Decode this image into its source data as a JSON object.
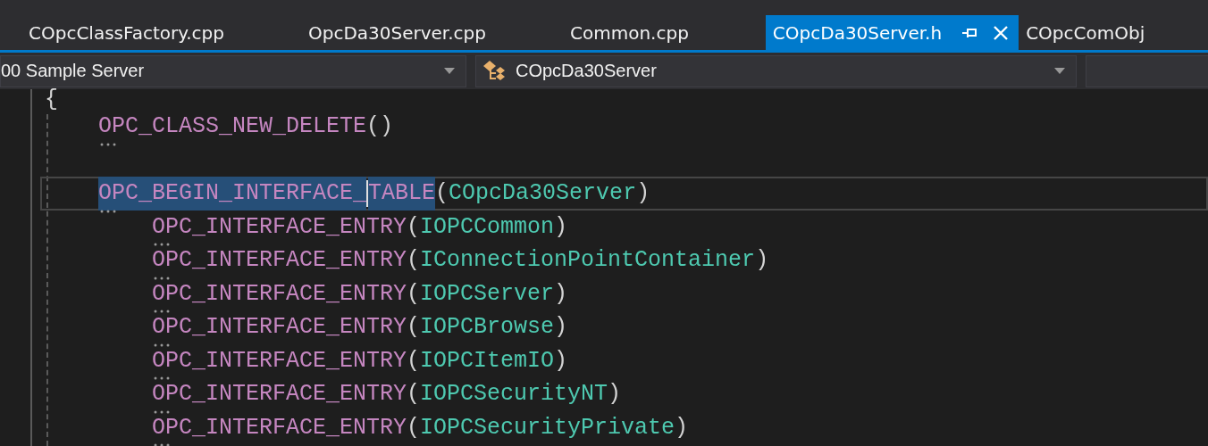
{
  "tabs": [
    {
      "label": "COpcClassFactory.cpp",
      "selected": false
    },
    {
      "label": "OpcDa30Server.cpp",
      "selected": false
    },
    {
      "label": "Common.cpp",
      "selected": false
    },
    {
      "label": "COpcDa30Server.h",
      "selected": true
    },
    {
      "label": "COpcComObj",
      "selected": false
    }
  ],
  "navigation": {
    "project": "00 Sample Server",
    "scope": "COpcDa30Server"
  },
  "code_lines": [
    {
      "current": false,
      "tokens": [
        {
          "kind": "punct",
          "text": "{"
        }
      ]
    },
    {
      "current": false,
      "tokens": [
        {
          "kind": "indent"
        },
        {
          "kind": "macro",
          "text": "OPC_CLASS_NEW_DELETE",
          "hint": true
        },
        {
          "kind": "punct",
          "text": "()"
        }
      ]
    },
    {
      "current": false
    },
    {
      "current": true,
      "tokens": [
        {
          "kind": "indent"
        },
        {
          "kind": "macro",
          "text": "OPC_BEGIN_INTERFACE_",
          "hint": true,
          "selected": true
        },
        {
          "kind": "caret"
        },
        {
          "kind": "macro",
          "text": "TABLE",
          "selected": true
        },
        {
          "kind": "punct",
          "text": "("
        },
        {
          "kind": "type",
          "text": "COpcDa30Server"
        },
        {
          "kind": "punct",
          "text": ")"
        }
      ]
    },
    {
      "current": false,
      "tokens": [
        {
          "kind": "indent"
        },
        {
          "kind": "indent"
        },
        {
          "kind": "macro",
          "text": "OPC_INTERFACE_ENTRY",
          "hint": true
        },
        {
          "kind": "punct",
          "text": "("
        },
        {
          "kind": "type",
          "text": "IOPCCommon"
        },
        {
          "kind": "punct",
          "text": ")"
        }
      ]
    },
    {
      "current": false,
      "tokens": [
        {
          "kind": "indent"
        },
        {
          "kind": "indent"
        },
        {
          "kind": "macro",
          "text": "OPC_INTERFACE_ENTRY",
          "hint": true
        },
        {
          "kind": "punct",
          "text": "("
        },
        {
          "kind": "type",
          "text": "IConnectionPointContainer"
        },
        {
          "kind": "punct",
          "text": ")"
        }
      ]
    },
    {
      "current": false,
      "tokens": [
        {
          "kind": "indent"
        },
        {
          "kind": "indent"
        },
        {
          "kind": "macro",
          "text": "OPC_INTERFACE_ENTRY",
          "hint": true
        },
        {
          "kind": "punct",
          "text": "("
        },
        {
          "kind": "type",
          "text": "IOPCServer"
        },
        {
          "kind": "punct",
          "text": ")"
        }
      ]
    },
    {
      "current": false,
      "tokens": [
        {
          "kind": "indent"
        },
        {
          "kind": "indent"
        },
        {
          "kind": "macro",
          "text": "OPC_INTERFACE_ENTRY",
          "hint": true
        },
        {
          "kind": "punct",
          "text": "("
        },
        {
          "kind": "type",
          "text": "IOPCBrowse"
        },
        {
          "kind": "punct",
          "text": ")"
        }
      ]
    },
    {
      "current": false,
      "tokens": [
        {
          "kind": "indent"
        },
        {
          "kind": "indent"
        },
        {
          "kind": "macro",
          "text": "OPC_INTERFACE_ENTRY",
          "hint": true
        },
        {
          "kind": "punct",
          "text": "("
        },
        {
          "kind": "type",
          "text": "IOPCItemIO"
        },
        {
          "kind": "punct",
          "text": ")"
        }
      ]
    },
    {
      "current": false,
      "tokens": [
        {
          "kind": "indent"
        },
        {
          "kind": "indent"
        },
        {
          "kind": "macro",
          "text": "OPC_INTERFACE_ENTRY",
          "hint": true
        },
        {
          "kind": "punct",
          "text": "("
        },
        {
          "kind": "type",
          "text": "IOPCSecurityNT"
        },
        {
          "kind": "punct",
          "text": ")"
        }
      ]
    },
    {
      "current": false,
      "tokens": [
        {
          "kind": "indent"
        },
        {
          "kind": "indent"
        },
        {
          "kind": "macro",
          "text": "OPC_INTERFACE_ENTRY",
          "hint": true
        },
        {
          "kind": "punct",
          "text": "("
        },
        {
          "kind": "type",
          "text": "IOPCSecurityPrivate"
        },
        {
          "kind": "punct",
          "text": ")"
        }
      ]
    }
  ]
}
